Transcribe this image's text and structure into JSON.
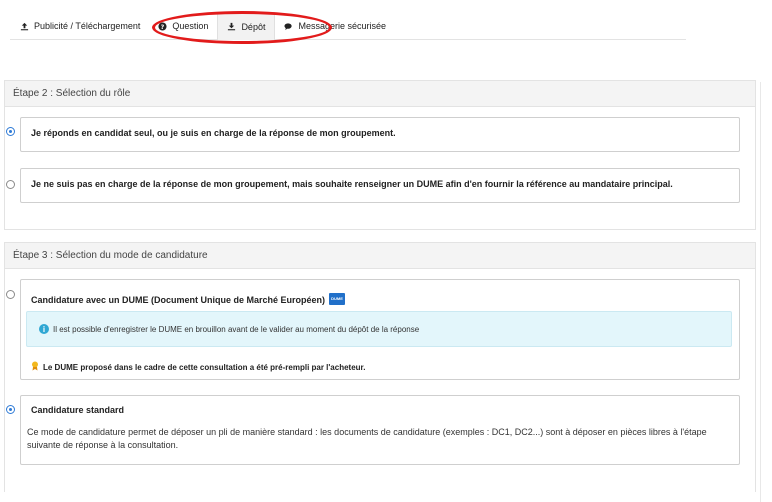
{
  "tabs": [
    {
      "label": "Publicité / Téléchargement",
      "icon": "upload-icon"
    },
    {
      "label": "Question",
      "icon": "question-circle-icon"
    },
    {
      "label": "Dépôt",
      "icon": "download-icon"
    },
    {
      "label": "Messagerie sécurisée",
      "icon": "comments-icon"
    }
  ],
  "step2": {
    "title": "Étape 2 : Sélection du rôle",
    "options": [
      {
        "label": "Je réponds en candidat seul, ou je suis en charge de la réponse de mon groupement.",
        "selected": true
      },
      {
        "label": "Je ne suis pas en charge de la réponse de mon groupement, mais souhaite renseigner un DUME afin d'en fournir la référence au mandataire principal.",
        "selected": false
      }
    ]
  },
  "step3": {
    "title": "Étape 3 : Sélection du mode de candidature",
    "dume_option": {
      "label": "Candidature avec un DUME (Document Unique de Marché Européen)",
      "badge": "DUME",
      "selected": false,
      "info": "Il est possible d'enregistrer le DUME en brouillon avant de le valider au moment du dépôt de la réponse",
      "note": "Le DUME proposé dans le cadre de cette consultation a été pré-rempli par l'acheteur."
    },
    "standard_option": {
      "label": "Candidature standard",
      "selected": true,
      "description": "Ce mode de candidature permet de déposer un pli de manière standard : les documents de candidature (exemples : DC1, DC2...) sont à déposer en pièces libres à l'étape suivante de réponse à la consultation."
    }
  },
  "colors": {
    "accent": "#2f7bd6",
    "highlight": "#e21b1b",
    "info_bg": "#e3f6fb"
  }
}
